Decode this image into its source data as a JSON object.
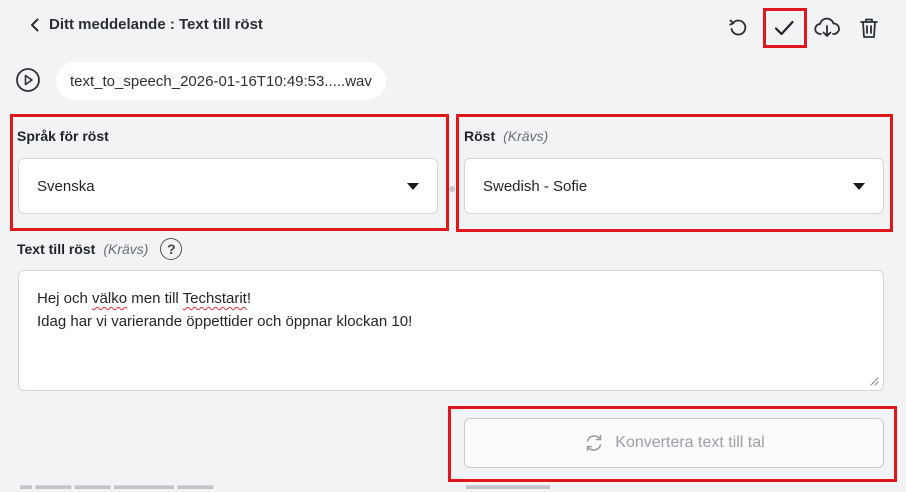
{
  "header": {
    "title": "Ditt meddelande : Text till röst",
    "icons": [
      "chevron-left-icon",
      "reset-icon",
      "check-icon",
      "cloud-download-icon",
      "trash-icon"
    ]
  },
  "audio": {
    "file_name": "text_to_speech_2026-01-16T10:49:53.....wav",
    "icon": "play-circle-icon"
  },
  "language": {
    "label": "Språk för röst",
    "value": "Svenska"
  },
  "voice": {
    "label": "Röst",
    "required": "(Krävs)",
    "value": "Swedish - Sofie"
  },
  "text": {
    "label": "Text till röst",
    "required": "(Krävs)",
    "help": "?",
    "line1_a": "Hej och ",
    "line1_b": "välko",
    "line1_c": " men till ",
    "line1_d": "Techstarit",
    "line1_e": "!",
    "line2": "Idag har vi varierande öppettider och öppnar klockan 10!"
  },
  "convert": {
    "label": "Konvertera text till tal",
    "icon": "refresh-icon"
  },
  "colors": {
    "highlight": "#e1171e",
    "background": "#f2f3f5"
  }
}
